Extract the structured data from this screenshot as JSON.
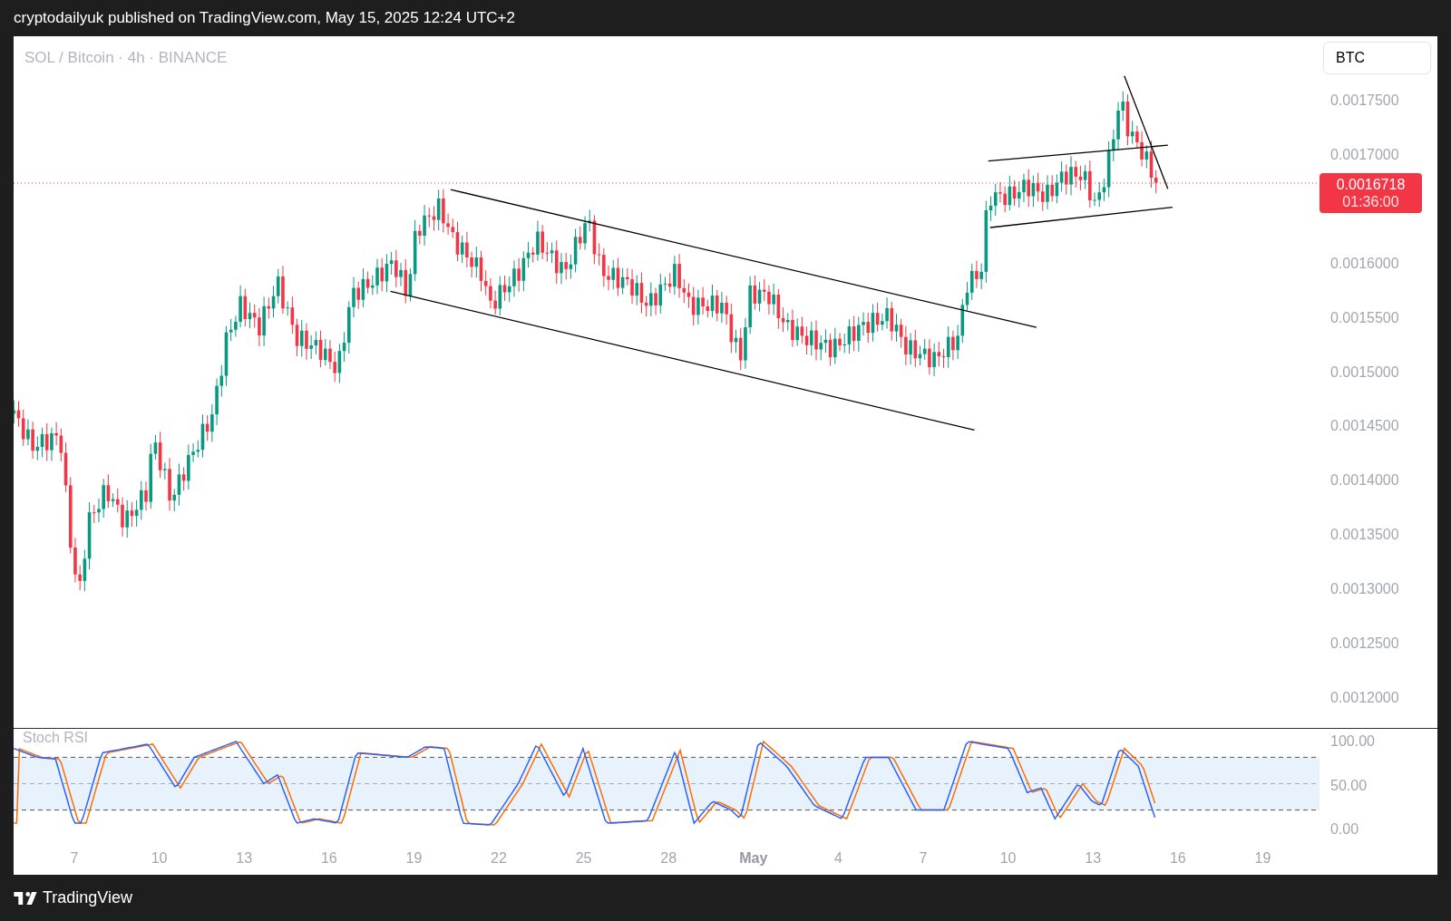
{
  "publish_line": "cryptodailyuk published on TradingView.com, May 15, 2025 12:24 UTC+2",
  "chart": {
    "symbol_title": "SOL / Bitcoin · 4h · BINANCE",
    "currency_button": "BTC",
    "price_axis": [
      "0.0017500",
      "0.0017000",
      "0.0016000",
      "0.0015500",
      "0.0015000",
      "0.0014500",
      "0.0014000",
      "0.0013500",
      "0.0013000",
      "0.0012500",
      "0.0012000"
    ],
    "last_price": {
      "price": "0.0016718",
      "countdown": "01:36:00"
    },
    "indicator": {
      "name": "Stoch RSI",
      "axis": [
        "100.00",
        "50.00",
        "0.00"
      ]
    },
    "date_axis": [
      {
        "label": "7",
        "kind": "day"
      },
      {
        "label": "10",
        "kind": "day"
      },
      {
        "label": "13",
        "kind": "day"
      },
      {
        "label": "16",
        "kind": "day"
      },
      {
        "label": "19",
        "kind": "day"
      },
      {
        "label": "22",
        "kind": "day"
      },
      {
        "label": "25",
        "kind": "day"
      },
      {
        "label": "28",
        "kind": "day"
      },
      {
        "label": "May",
        "kind": "month"
      },
      {
        "label": "4",
        "kind": "day"
      },
      {
        "label": "7",
        "kind": "day"
      },
      {
        "label": "10",
        "kind": "day"
      },
      {
        "label": "13",
        "kind": "day"
      },
      {
        "label": "16",
        "kind": "day"
      },
      {
        "label": "19",
        "kind": "day"
      }
    ]
  },
  "footer": {
    "logo_text": "TradingView"
  }
}
